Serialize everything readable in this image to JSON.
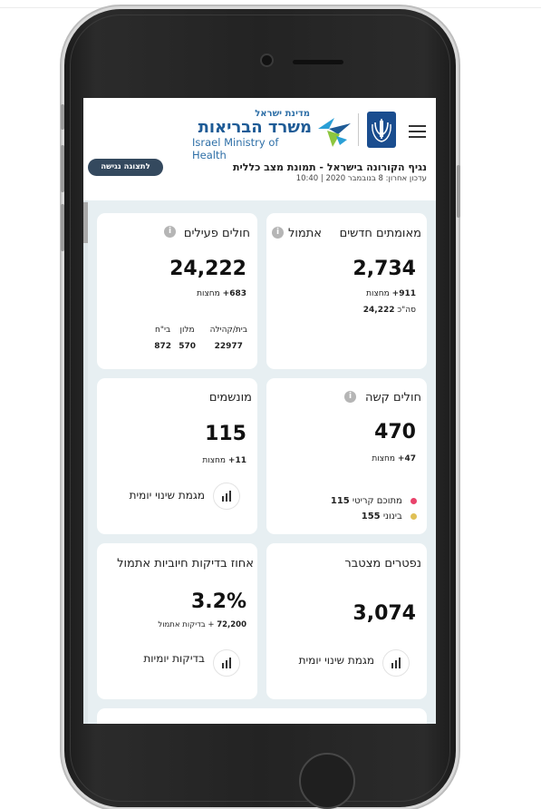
{
  "header": {
    "logo_top": "מדינת ישראל",
    "logo_main": "משרד הבריאות",
    "logo_en": "Israel Ministry of Health",
    "title": "נגיף הקורונה בישראל - תמונת מצב כללית",
    "updated": "עדכון אחרון: 8 בנובמבר 2020 | 10:40",
    "accessible_view": "לתצוגה נגישה"
  },
  "cards": {
    "new_confirmed": {
      "title": "מאומתים חדשים",
      "title_suffix": "אתמול",
      "value": "2,734",
      "midnight_delta": "+911",
      "midnight_label": "מחצות",
      "total_value": "24,222",
      "total_label": "סה\"כ"
    },
    "active": {
      "title": "חולים פעילים",
      "value": "24,222",
      "delta": "+683",
      "delta_label": "מחצות",
      "split": [
        {
          "label": "בית/קהילה",
          "value": "22977"
        },
        {
          "label": "מלון",
          "value": "570"
        },
        {
          "label": "בי\"ח",
          "value": "872"
        }
      ]
    },
    "serious": {
      "title": "חולים קשה",
      "value": "470",
      "delta": "+47",
      "delta_label": "מחצות",
      "legend": [
        {
          "label": "מתוכם קריטי",
          "value": "115",
          "color": "#e9436b"
        },
        {
          "label": "בינוני",
          "value": "155",
          "color": "#e0c056"
        }
      ]
    },
    "ventilated": {
      "title": "מונשמים",
      "value": "115",
      "delta": "+11",
      "delta_label": "מחצות",
      "chart_label": "מגמת שינוי יומית"
    },
    "deceased": {
      "title": "נפטרים מצטבר",
      "value": "3,074",
      "chart_label": "מגמת שינוי יומית"
    },
    "positive_rate": {
      "title": "אחוז בדיקות חיוביות אתמול",
      "value": "3.2%",
      "tests_value": "72,200",
      "tests_label": "+ בדיקות אתמול",
      "chart_label": "בדיקות יומיות"
    }
  },
  "colors": {
    "brand_blue": "#1e5b96",
    "button_dark": "#34495e",
    "screen_bg": "#e7eff2"
  }
}
